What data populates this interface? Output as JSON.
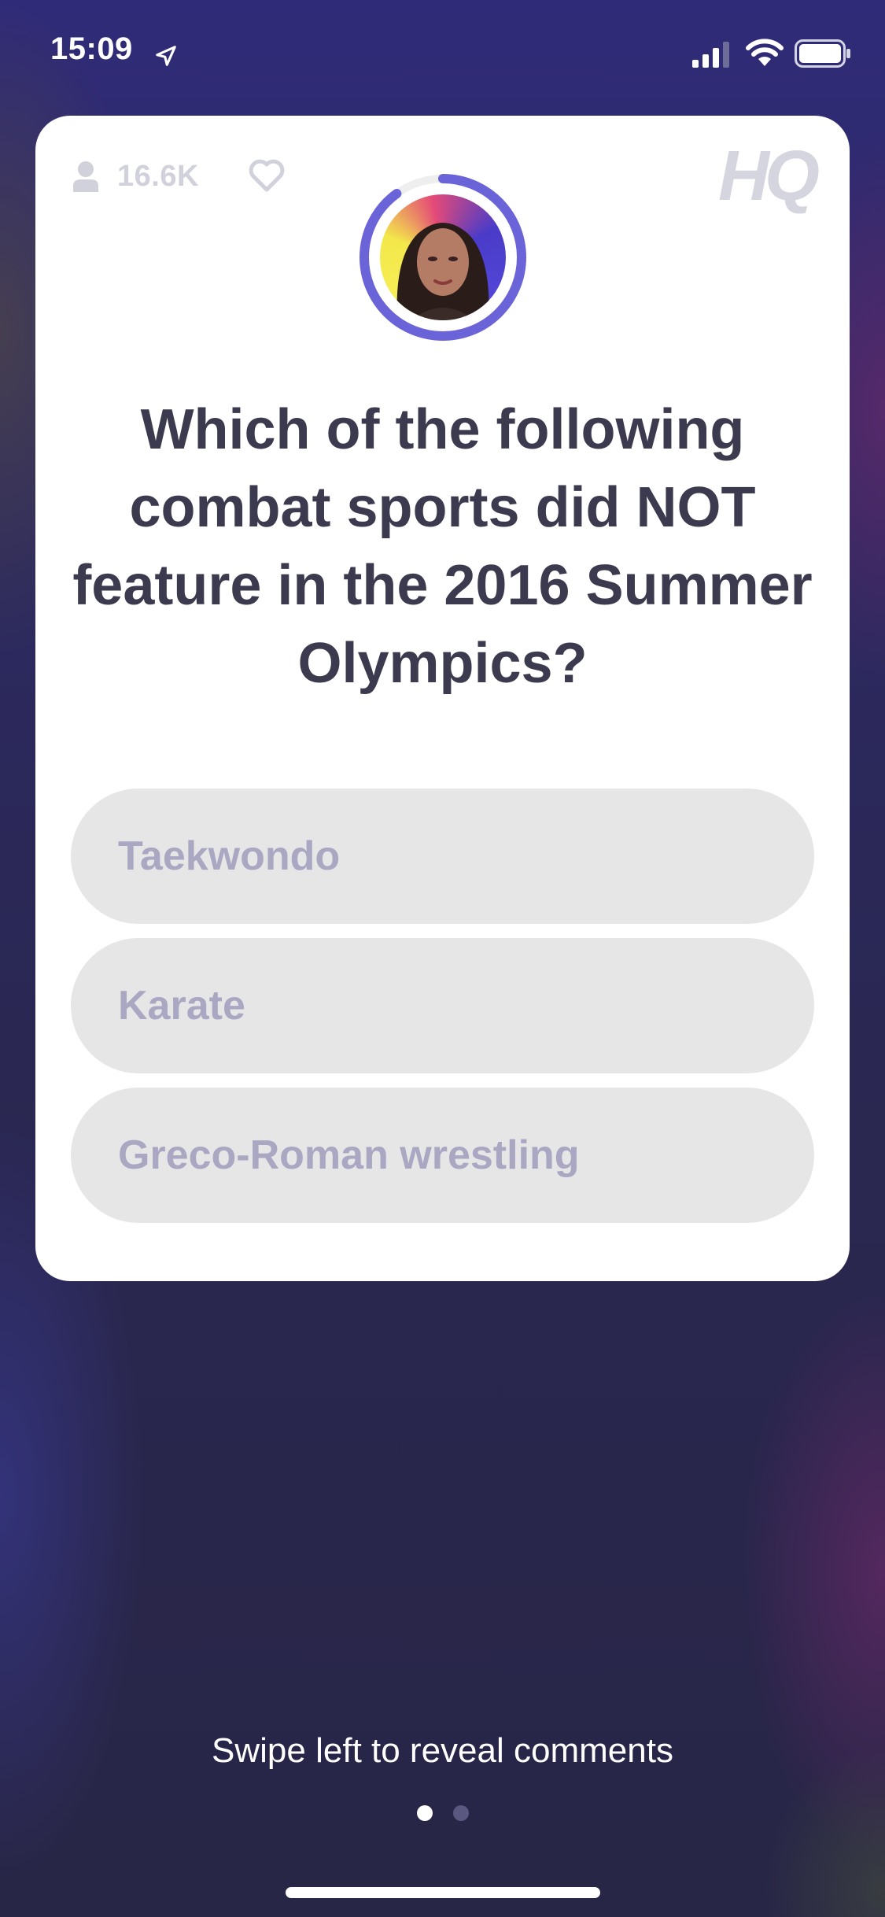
{
  "status_bar": {
    "time": "15:09",
    "icons": [
      "location-arrow-icon",
      "signal-icon",
      "wifi-icon",
      "battery-icon"
    ]
  },
  "card": {
    "viewer_count": "16.6K",
    "logo": "HQ",
    "timer_progress": 0.9,
    "question": "Which of the following combat sports did NOT feature in the 2016 Summer Olympics?",
    "answers": [
      "Taekwondo",
      "Karate",
      "Greco-Roman wrestling"
    ]
  },
  "footer": {
    "hint": "Swipe left to reveal comments",
    "pages": 2,
    "active_page": 1
  },
  "colors": {
    "accent": "#6b64d8",
    "answer_bg": "#e6e6e6",
    "answer_text": "#a9a7c2",
    "question_text": "#3b3a4e"
  }
}
